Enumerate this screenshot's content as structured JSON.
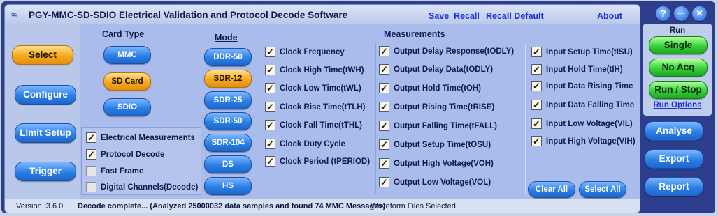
{
  "app": {
    "title": "PGY-MMC-SD-SDIO Electrical Validation and Protocol Decode Software",
    "logo": "∞",
    "links": {
      "save": "Save",
      "recall": "Recall",
      "recall_default": "Recall Default",
      "about": "About"
    }
  },
  "nav": {
    "items": [
      {
        "label": "Select",
        "selected": true
      },
      {
        "label": "Configure",
        "selected": false
      },
      {
        "label": "Limit Setup",
        "selected": false
      },
      {
        "label": "Trigger",
        "selected": false
      }
    ]
  },
  "card_type": {
    "title": "Card Type",
    "options": [
      {
        "label": "MMC",
        "selected": false
      },
      {
        "label": "SD Card",
        "selected": true
      },
      {
        "label": "SDIO",
        "selected": false
      }
    ]
  },
  "mode": {
    "title": "Mode",
    "options": [
      {
        "label": "DDR-50",
        "selected": false
      },
      {
        "label": "SDR-12",
        "selected": true
      },
      {
        "label": "SDR-25",
        "selected": false
      },
      {
        "label": "SDR-50",
        "selected": false
      },
      {
        "label": "SDR-104",
        "selected": false
      },
      {
        "label": "DS",
        "selected": false
      },
      {
        "label": "HS",
        "selected": false
      }
    ]
  },
  "options": [
    {
      "label": "Electrical Measurements",
      "checked": true
    },
    {
      "label": "Protocol Decode",
      "checked": true
    },
    {
      "label": "Fast Frame",
      "checked": false
    },
    {
      "label": "Digital Channels(Decode)",
      "checked": false
    }
  ],
  "measurements": {
    "title": "Measurements",
    "col1": [
      {
        "label": "Clock Frequency",
        "checked": true
      },
      {
        "label": "Clock High Time(tWH)",
        "checked": true
      },
      {
        "label": "Clock Low Time(tWL)",
        "checked": true
      },
      {
        "label": "Clock Rise Time(tTLH)",
        "checked": true
      },
      {
        "label": "Clock Fall Time(tTHL)",
        "checked": true
      },
      {
        "label": "Clock Duty Cycle",
        "checked": true
      },
      {
        "label": "Clock Period (tPERIOD)",
        "checked": true
      }
    ],
    "col2": [
      {
        "label": "Output Delay Response(tODLY)",
        "checked": true
      },
      {
        "label": "Output Delay Data(tODLY)",
        "checked": true
      },
      {
        "label": "Output Hold Time(tOH)",
        "checked": true
      },
      {
        "label": "Output  Rising Time(tRISE)",
        "checked": true
      },
      {
        "label": "Output Falling Time(tFALL)",
        "checked": true
      },
      {
        "label": "Output Setup Time(tOSU)",
        "checked": true
      },
      {
        "label": "Output High Voltage(VOH)",
        "checked": true
      },
      {
        "label": "Output Low Voltage(VOL)",
        "checked": true
      }
    ],
    "col3": [
      {
        "label": "Input Setup Time(tISU)",
        "checked": true
      },
      {
        "label": "Input Hold Time(tIH)",
        "checked": true
      },
      {
        "label": "Input Data Rising Time",
        "checked": true
      },
      {
        "label": "Input Data Falling Time",
        "checked": true
      },
      {
        "label": "Input Low Voltage(VIL)",
        "checked": true
      },
      {
        "label": "Input High Voltage(VIH)",
        "checked": true
      }
    ],
    "clear_all": "Clear All",
    "select_all": "Select All"
  },
  "run": {
    "title": "Run",
    "single": "Single",
    "no_acq": "No Acq",
    "run_stop": "Run / Stop",
    "run_options": "Run Options"
  },
  "right_actions": {
    "analyse": "Analyse",
    "export": "Export",
    "report": "Report"
  },
  "window_controls": {
    "help": "?",
    "minimize": "—",
    "close": "✕"
  },
  "status": {
    "version": "Version :3.6.0",
    "message": "Decode complete... (Analyzed 25000032 data samples and found 74 MMC Messages)",
    "files": "Waveform Files Selected"
  },
  "colors": {
    "accent_blue": "#2a7fe6",
    "selected_orange": "#f5a81f",
    "run_green": "#38d13a",
    "frame_navy": "#2c3e8c"
  }
}
